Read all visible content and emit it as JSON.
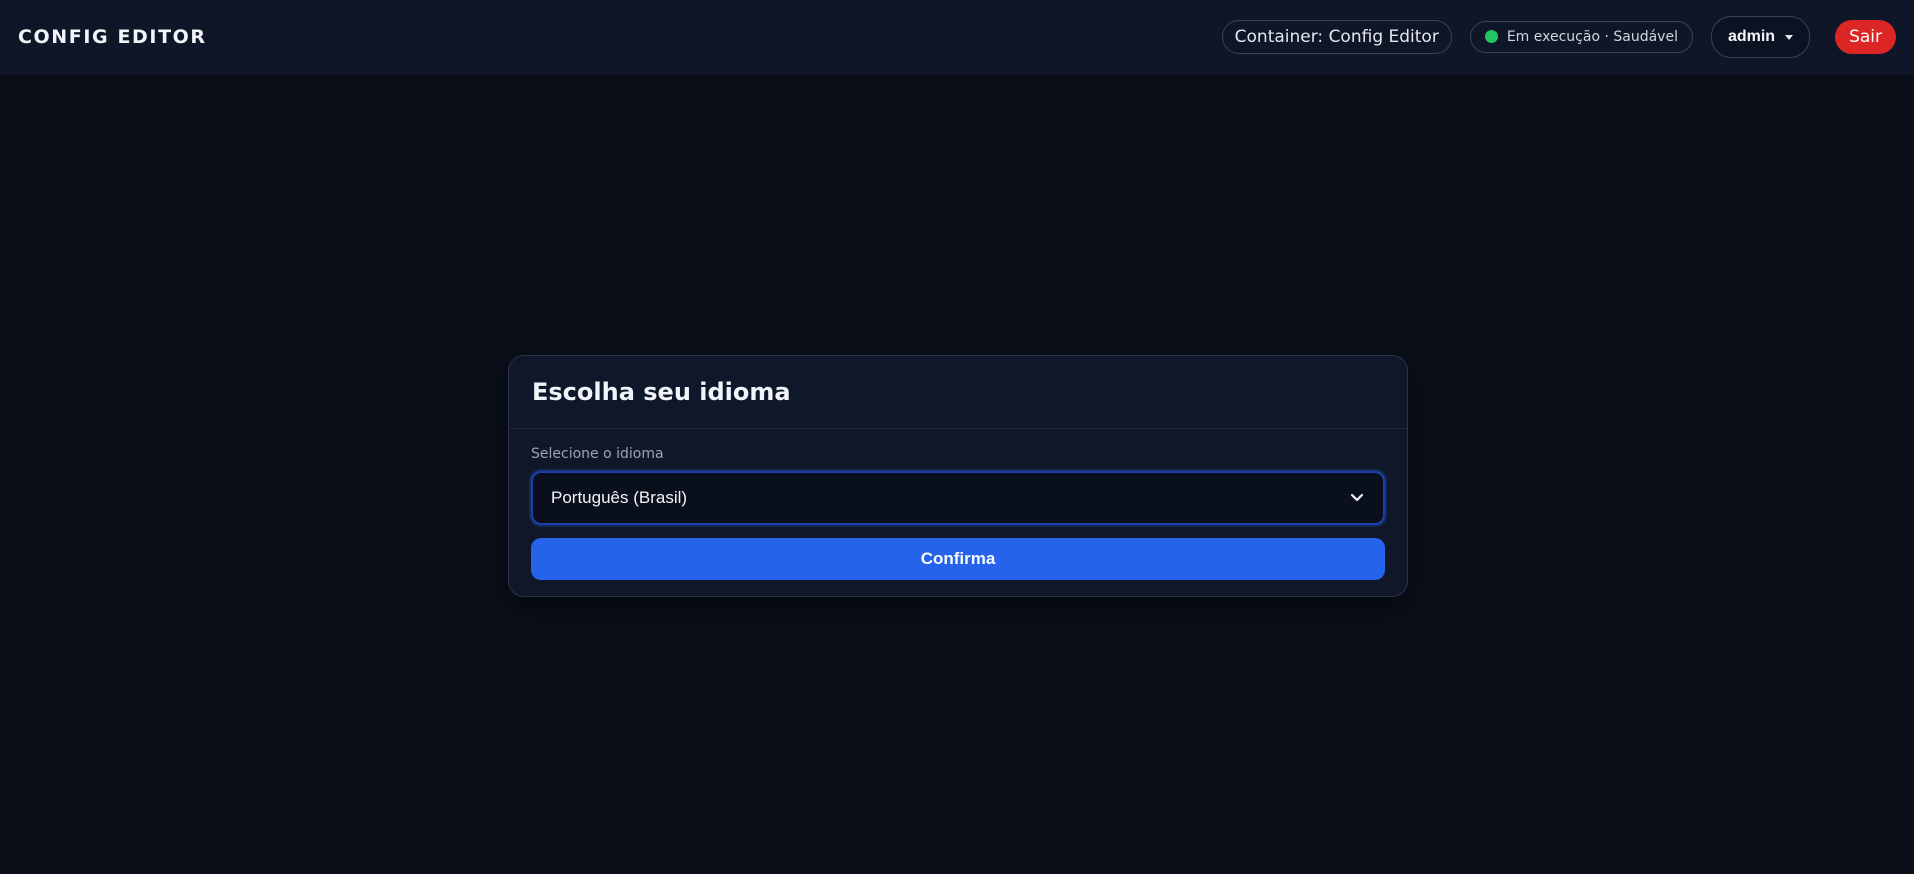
{
  "header": {
    "brand": "CONFIG EDITOR",
    "container_label": "Container: Config Editor",
    "status_text": "Em execução · Saudável",
    "status_color": "#22c55e",
    "user_label": "admin",
    "logout_label": "Sair"
  },
  "language_card": {
    "title": "Escolha seu idioma",
    "field_label": "Selecione o idioma",
    "selected_language": "Português (Brasil)",
    "confirm_label": "Confirma"
  },
  "colors": {
    "accent": "#2563eb",
    "danger": "#dc2626",
    "background": "#0a0f1a"
  },
  "icons": {
    "status": "status-dot-icon",
    "user_menu": "caret-down-icon",
    "select": "chevron-down-icon"
  }
}
